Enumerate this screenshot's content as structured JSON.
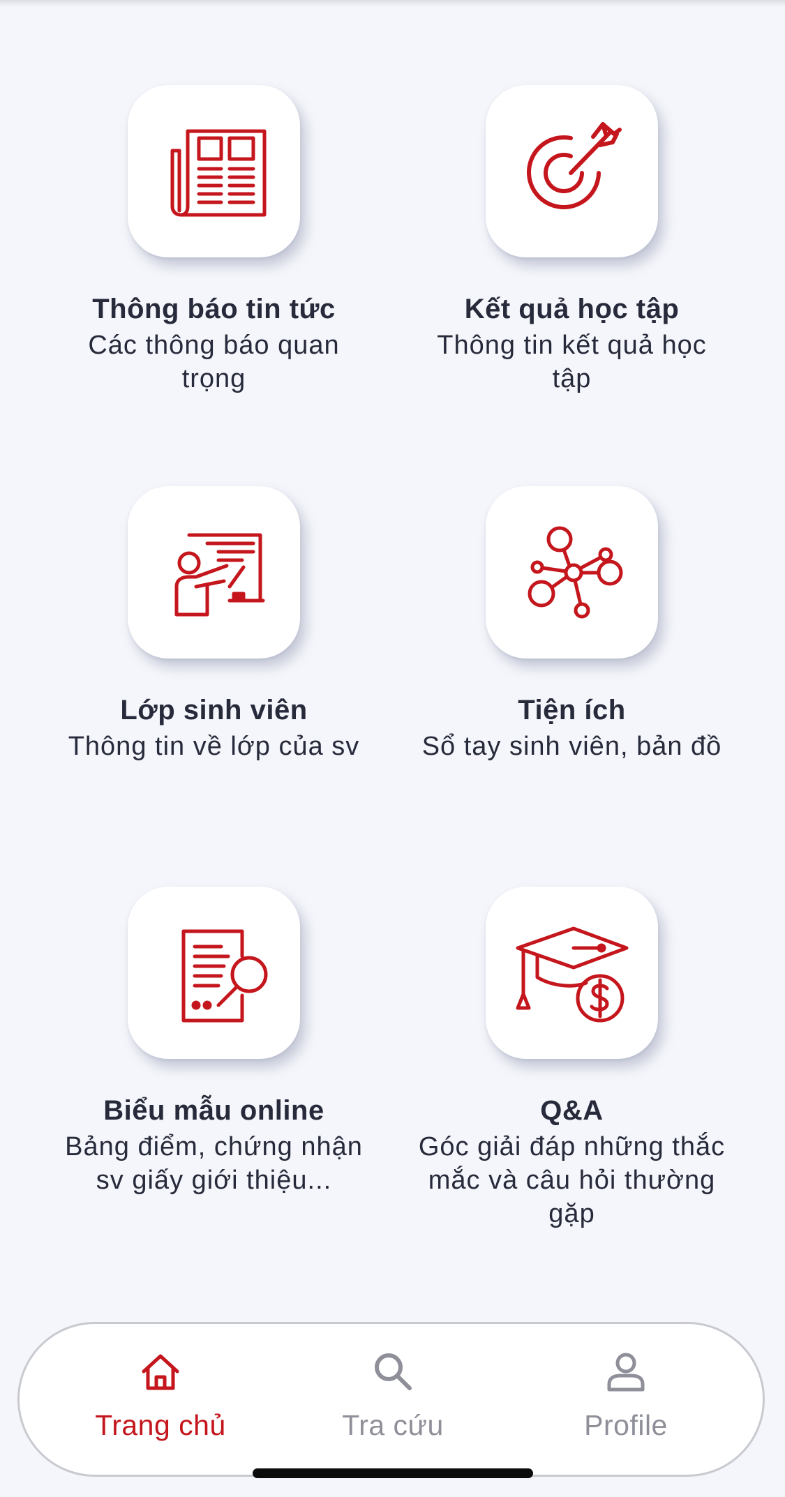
{
  "colors": {
    "accent": "#c4161c",
    "text": "#272a3a",
    "inactive": "#8e8f98",
    "background": "#f5f6fb"
  },
  "tiles": [
    {
      "icon": "newspaper-icon",
      "title": "Thông báo tin tức",
      "desc": "Các thông báo quan trọng"
    },
    {
      "icon": "target-icon",
      "title": "Kết quả học tập",
      "desc": "Thông tin kết quả học tập"
    },
    {
      "icon": "teacher-board-icon",
      "title": "Lớp sinh viên",
      "desc": "Thông tin về lớp của sv"
    },
    {
      "icon": "network-nodes-icon",
      "title": "Tiện ích",
      "desc": "Sổ tay sinh viên, bản đồ"
    },
    {
      "icon": "document-search-icon",
      "title": "Biểu mẫu online",
      "desc": "Bảng điểm, chứng nhận sv giấy giới thiệu..."
    },
    {
      "icon": "graduation-cap-dollar-icon",
      "title": "Q&A",
      "desc": "Góc giải đáp những thắc mắc và câu hỏi thường gặp"
    }
  ],
  "nav": {
    "items": [
      {
        "icon": "home-icon",
        "label": "Trang chủ",
        "active": true
      },
      {
        "icon": "search-icon",
        "label": "Tra cứu",
        "active": false
      },
      {
        "icon": "user-icon",
        "label": "Profile",
        "active": false
      }
    ]
  }
}
